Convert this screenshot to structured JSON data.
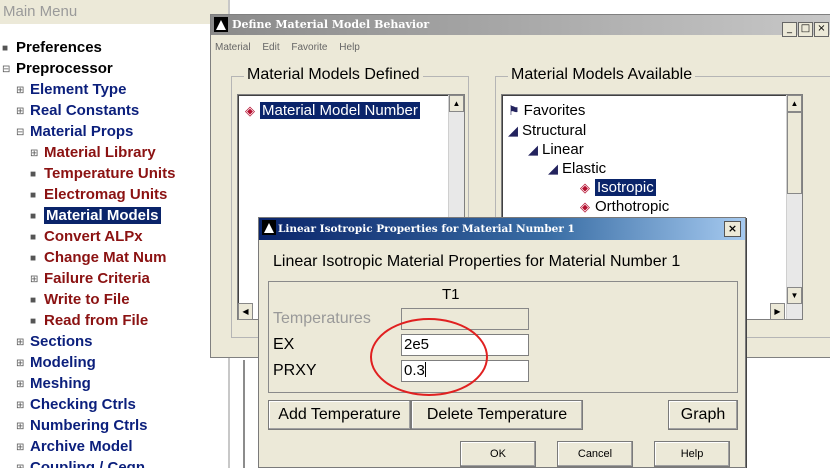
{
  "main_menu": {
    "title": "Main Menu",
    "items": [
      {
        "label": "Preferences",
        "icon": "■"
      },
      {
        "label": "Preprocessor",
        "icon": "⊟"
      },
      {
        "label": "Element Type",
        "icon": "⊞"
      },
      {
        "label": "Real Constants",
        "icon": "⊞"
      },
      {
        "label": "Material Props",
        "icon": "⊟"
      },
      {
        "label": "Material Library",
        "icon": "⊞"
      },
      {
        "label": "Temperature Units",
        "icon": "■"
      },
      {
        "label": "Electromag Units",
        "icon": "■"
      },
      {
        "label": "Material Models",
        "icon": "■"
      },
      {
        "label": "Convert ALPx",
        "icon": "■"
      },
      {
        "label": "Change Mat Num",
        "icon": "■"
      },
      {
        "label": "Failure Criteria",
        "icon": "⊞"
      },
      {
        "label": "Write to File",
        "icon": "■"
      },
      {
        "label": "Read from File",
        "icon": "■"
      },
      {
        "label": "Sections",
        "icon": "⊞"
      },
      {
        "label": "Modeling",
        "icon": "⊞"
      },
      {
        "label": "Meshing",
        "icon": "⊞"
      },
      {
        "label": "Checking Ctrls",
        "icon": "⊞"
      },
      {
        "label": "Numbering Ctrls",
        "icon": "⊞"
      },
      {
        "label": "Archive Model",
        "icon": "⊞"
      },
      {
        "label": "Coupling / Ceqn",
        "icon": "⊞"
      }
    ]
  },
  "material_window": {
    "title": "Define Material Model Behavior",
    "menu": [
      "Material",
      "Edit",
      "Favorite",
      "Help"
    ],
    "controls": {
      "minimize": "_",
      "maximize": "□",
      "close": "×"
    },
    "defined_group": {
      "title": "Material Models Defined",
      "items": [
        "Material Model Number"
      ]
    },
    "available_group": {
      "title": "Material Models Available",
      "items": [
        "Favorites",
        "Structural",
        "Linear",
        "Elastic",
        "Isotropic",
        "Orthotropic"
      ]
    }
  },
  "iso_dialog": {
    "title": "Linear Isotropic Properties for Material Number 1",
    "close": "×",
    "heading": "Linear Isotropic Material Properties for Material Number 1",
    "column_header": "T1",
    "rows": [
      {
        "label": "Temperatures",
        "value": ""
      },
      {
        "label": "EX",
        "value": "2e5"
      },
      {
        "label": "PRXY",
        "value": "0.3"
      }
    ],
    "buttons": {
      "add_temperature": "Add Temperature",
      "delete_temperature": "Delete Temperature",
      "graph": "Graph",
      "ok": "OK",
      "cancel": "Cancel",
      "help": "Help"
    }
  },
  "colors": {
    "selection": "#0a246a",
    "tree_blue": "#0b1f7c",
    "tree_red": "#8b1212",
    "dialog_bg": "#ece9d8",
    "annotation": "#e02020"
  }
}
